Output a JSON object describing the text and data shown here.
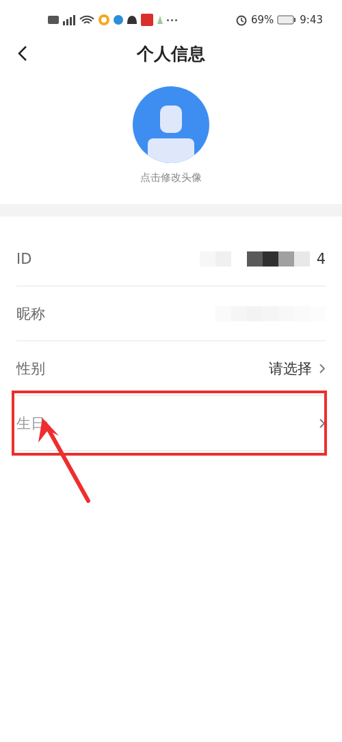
{
  "status_bar": {
    "battery": "69%",
    "time": "9:43"
  },
  "header": {
    "title": "个人信息"
  },
  "avatar": {
    "caption": "点击修改头像"
  },
  "rows": [
    {
      "label": "ID",
      "value": "4",
      "redacted": true,
      "arrow": false,
      "highlighted": false,
      "muted": false
    },
    {
      "label": "昵称",
      "redacted": true,
      "arrow": false,
      "highlighted": false,
      "muted": false
    },
    {
      "label": "性别",
      "value": "请选择",
      "redacted": false,
      "arrow": true,
      "highlighted": false,
      "muted": false
    },
    {
      "label": "生日",
      "redacted": false,
      "arrow": true,
      "highlighted": true,
      "muted": true
    }
  ]
}
